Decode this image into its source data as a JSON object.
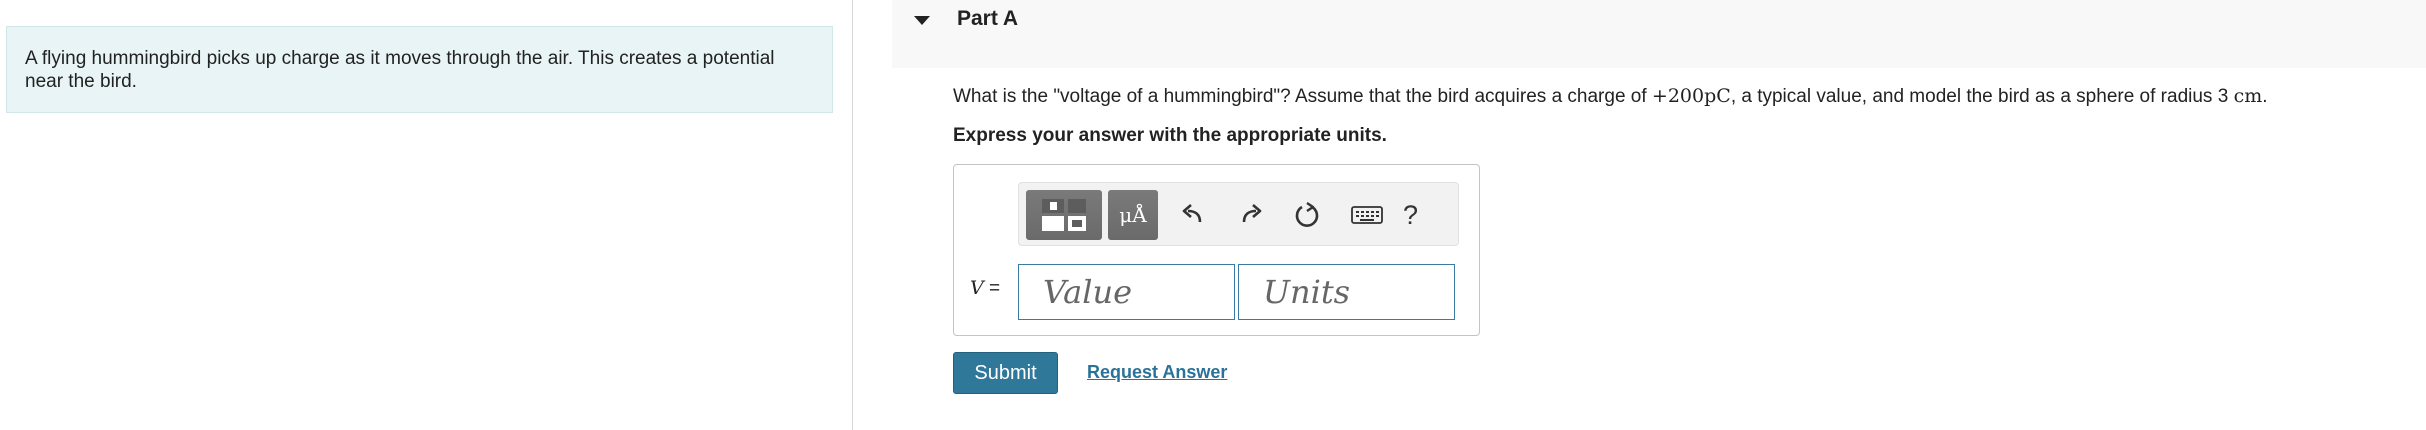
{
  "intro": {
    "text": "A flying hummingbird picks up charge as it moves through the air. This creates a potential near the bird."
  },
  "part": {
    "title": "Part A",
    "toggle_icon": "caret-down-icon"
  },
  "question": {
    "prefix": "What is the \"voltage of a hummingbird\"? Assume that the bird acquires a charge of ",
    "charge": "+200pC",
    "middle": ", a typical value, and model the bird as a sphere of radius 3 ",
    "radius_unit": "cm",
    "suffix": "."
  },
  "instruction": "Express your answer with the appropriate units.",
  "toolbar": {
    "template_icon": "templates-icon",
    "units_label": "μÅ",
    "undo_icon": "undo-icon",
    "redo_icon": "redo-icon",
    "reset_icon": "reset-icon",
    "keyboard_icon": "keyboard-icon",
    "help_label": "?"
  },
  "answer": {
    "variable": "V",
    "equals": " =",
    "value_placeholder": "Value",
    "units_placeholder": "Units"
  },
  "actions": {
    "submit_label": "Submit",
    "request_label": "Request Answer"
  },
  "colors": {
    "intro_bg": "#e8f4f6",
    "submit_bg": "#2f789a",
    "link": "#2a7299",
    "input_border": "#3a7ba3"
  }
}
